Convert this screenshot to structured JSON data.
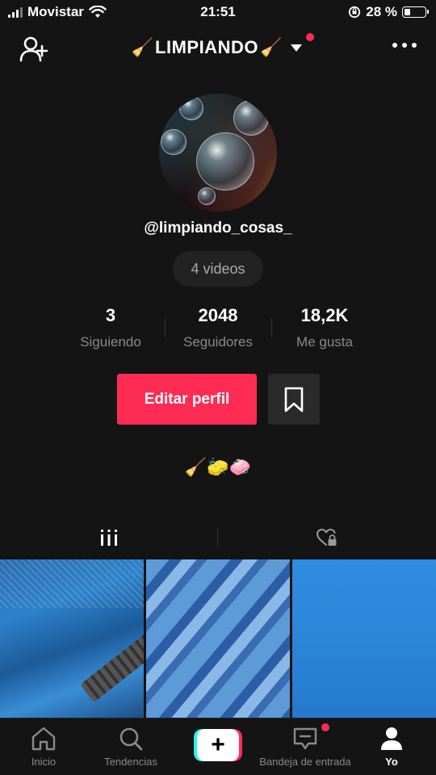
{
  "status_bar": {
    "carrier": "Movistar",
    "time": "21:51",
    "battery_percent": "28 %",
    "battery_level": 0.28
  },
  "header": {
    "title_emoji_left": "🧹",
    "title": "LIMPIANDO",
    "title_emoji_right": "🧹"
  },
  "profile": {
    "username": "@limpiando_cosas_",
    "videos_pill": "4 videos",
    "stats": [
      {
        "value": "3",
        "label": "Siguiendo"
      },
      {
        "value": "2048",
        "label": "Seguidores"
      },
      {
        "value": "18,2K",
        "label": "Me gusta"
      }
    ],
    "edit_button": "Editar perfil",
    "bio": "🧹🧽🧼"
  },
  "nav": {
    "items": [
      {
        "label": "Inicio",
        "icon": "home-icon"
      },
      {
        "label": "Tendencias",
        "icon": "search-icon"
      },
      {
        "label": "Bandeja de entrada",
        "icon": "inbox-icon"
      },
      {
        "label": "Yo",
        "icon": "profile-icon"
      }
    ]
  },
  "colors": {
    "background": "#141414",
    "accent": "#fe2c55",
    "cyan": "#25f4ee"
  }
}
